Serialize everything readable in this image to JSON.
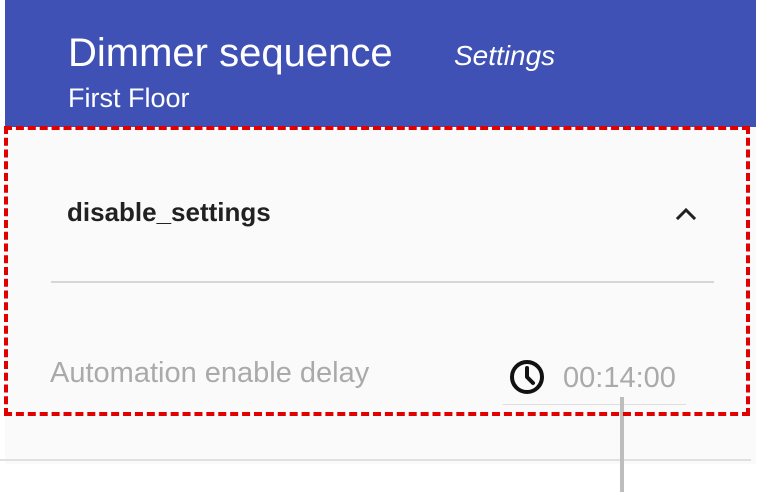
{
  "header": {
    "title": "Dimmer sequence",
    "subtitle": "Settings",
    "location": "First Floor",
    "background_color": "#3f51b5"
  },
  "section": {
    "title": "disable_settings",
    "expanded": true,
    "toggle_icon": "chevron-up-icon"
  },
  "field": {
    "label": "Automation enable delay",
    "value": "00:14:00",
    "icon": "clock-icon"
  },
  "highlight": {
    "color": "#e00000",
    "style": "dashed"
  }
}
